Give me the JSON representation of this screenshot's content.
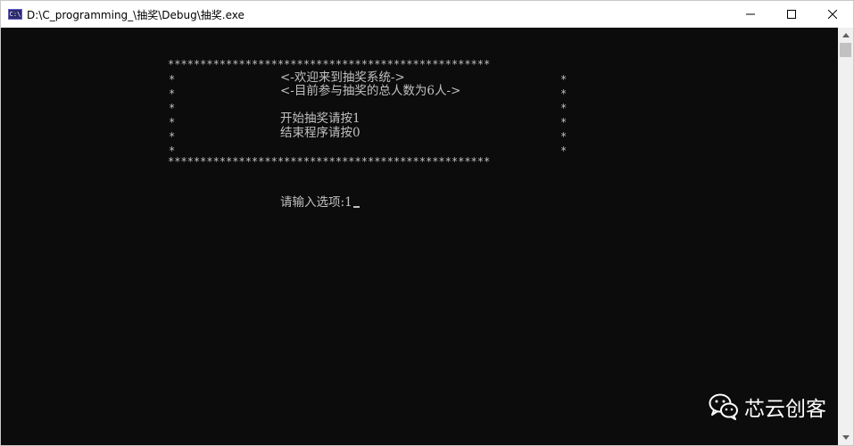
{
  "window": {
    "title": "D:\\C_programming_\\抽奖\\Debug\\抽奖.exe",
    "app_icon_text": "C:\\",
    "controls": [
      "minimize",
      "maximize",
      "close"
    ]
  },
  "console": {
    "border_top": "**************************************************",
    "border_bottom": "**************************************************",
    "side_char": "*",
    "welcome": "<-欢迎来到抽奖系统->",
    "participants": "<-目前参与抽奖的总人数为6人->",
    "option_start": "开始抽奖请按1",
    "option_end": "结束程序请按0",
    "prompt": "请输入选项:",
    "input_value": "1"
  },
  "watermark": {
    "text": "芯云创客",
    "icon": "wechat-icon"
  },
  "colors": {
    "console_bg": "#0c0c0c",
    "console_text": "#c0c0c0",
    "titlebar_bg": "#ffffff"
  }
}
